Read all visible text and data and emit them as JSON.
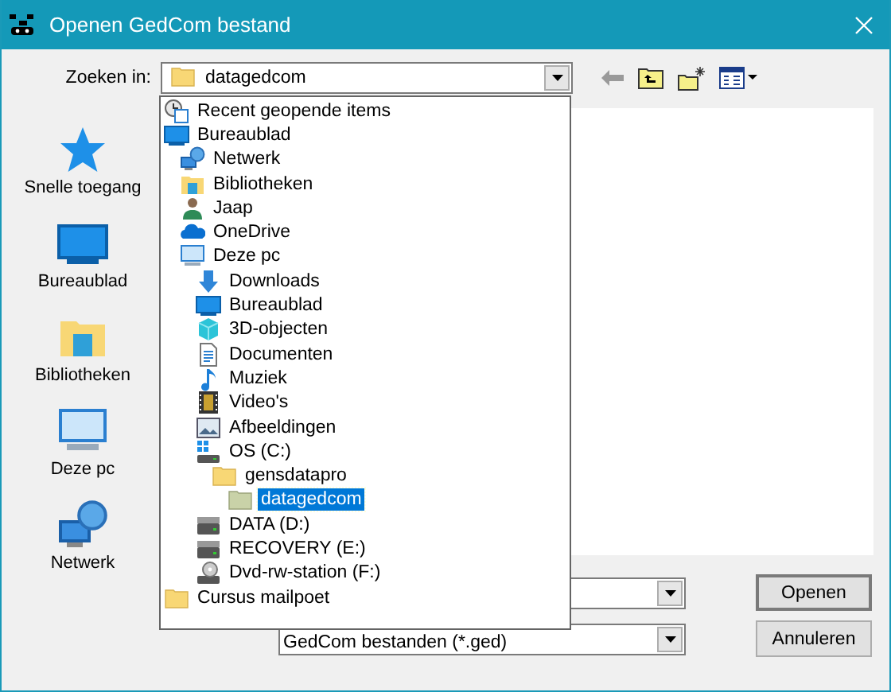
{
  "window": {
    "title": "Openen GedCom bestand"
  },
  "look_in": {
    "label": "Zoeken in:",
    "value": "datagedcom",
    "kind": "folder"
  },
  "toolbar": {
    "back_disabled": true
  },
  "places": [
    {
      "label": "Snelle toegang",
      "kind": "star"
    },
    {
      "label": "Bureaublad",
      "kind": "desktop"
    },
    {
      "label": "Bibliotheken",
      "kind": "library"
    },
    {
      "label": "Deze pc",
      "kind": "computer"
    },
    {
      "label": "Netwerk",
      "kind": "network"
    }
  ],
  "dropdown": [
    {
      "label": "Recent geopende items",
      "kind": "recent",
      "selected": false
    },
    {
      "label": "Bureaublad",
      "kind": "desktop",
      "selected": false,
      "children": [
        {
          "label": "Netwerk",
          "kind": "network",
          "selected": false
        },
        {
          "label": "Bibliotheken",
          "kind": "library",
          "selected": false
        },
        {
          "label": "Jaap",
          "kind": "user",
          "selected": false
        },
        {
          "label": "OneDrive",
          "kind": "cloud",
          "selected": false
        },
        {
          "label": "Deze pc",
          "kind": "computer",
          "selected": false,
          "children": [
            {
              "label": "Downloads",
              "kind": "download",
              "selected": false
            },
            {
              "label": "Bureaublad",
              "kind": "desktop",
              "selected": false
            },
            {
              "label": "3D-objecten",
              "kind": "cube",
              "selected": false
            },
            {
              "label": "Documenten",
              "kind": "document",
              "selected": false
            },
            {
              "label": "Muziek",
              "kind": "music",
              "selected": false
            },
            {
              "label": "Video's",
              "kind": "video",
              "selected": false
            },
            {
              "label": "Afbeeldingen",
              "kind": "image",
              "selected": false
            },
            {
              "label": "OS (C:)",
              "kind": "osdrive",
              "selected": false,
              "children": [
                {
                  "label": "gensdatapro",
                  "kind": "folder",
                  "selected": false,
                  "children": [
                    {
                      "label": "datagedcom",
                      "kind": "folder",
                      "selected": true
                    }
                  ]
                }
              ]
            },
            {
              "label": "DATA (D:)",
              "kind": "drive",
              "selected": false
            },
            {
              "label": "RECOVERY (E:)",
              "kind": "drive",
              "selected": false
            },
            {
              "label": "Dvd-rw-station (F:)",
              "kind": "dvd",
              "selected": false
            }
          ]
        }
      ]
    },
    {
      "label": "Cursus mailpoet",
      "kind": "folder",
      "selected": false
    }
  ],
  "file_type": {
    "value": "GedCom bestanden (*.ged)"
  },
  "buttons": [
    {
      "label": "Openen"
    },
    {
      "label": "Annuleren"
    }
  ]
}
